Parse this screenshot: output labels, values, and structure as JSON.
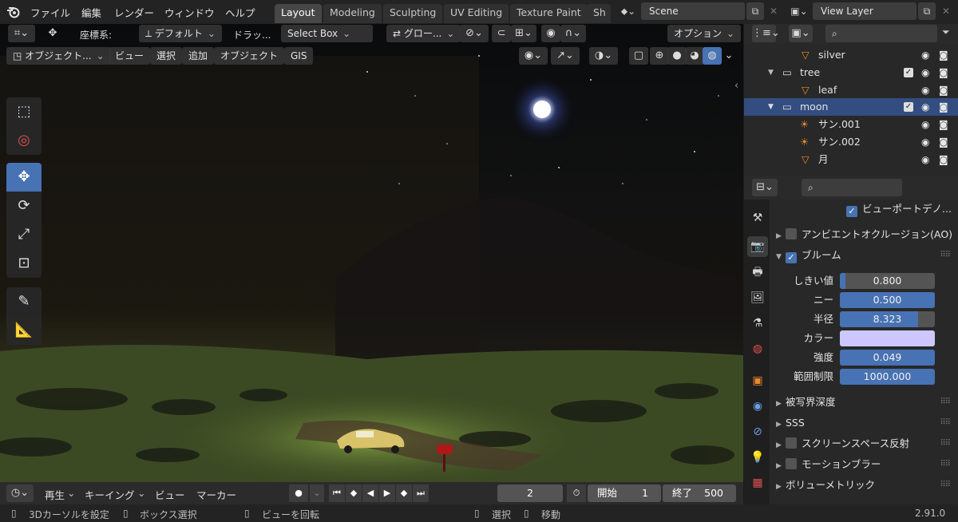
{
  "menubar": {
    "items": [
      "ファイル",
      "編集",
      "レンダー",
      "ウィンドウ",
      "ヘルプ"
    ],
    "workspaces": [
      "Layout",
      "Modeling",
      "Sculpting",
      "UV Editing",
      "Texture Paint",
      "Sh"
    ],
    "active_workspace": "Layout",
    "scene": "Scene",
    "view_layer": "View Layer"
  },
  "viewport_header": {
    "transform_label": "座標系:",
    "orientation": "デフォルト",
    "drag_label": "ドラッ...",
    "select_mode": "Select Box",
    "pivot": "グロー...",
    "options": "オプション",
    "mode": "オブジェクト...",
    "menus": [
      "ビュー",
      "選択",
      "追加",
      "オブジェクト",
      "GIS"
    ]
  },
  "timeline": {
    "playback": "再生",
    "keying": "キーイング",
    "view": "ビュー",
    "marker": "マーカー",
    "current_frame": "2",
    "start_label": "開始",
    "start": "1",
    "end_label": "終了",
    "end": "500"
  },
  "statusbar": {
    "left": "3Dカーソルを設定",
    "box": "ボックス選択",
    "rotate": "ビューを回転",
    "select": "選択",
    "move": "移動",
    "version": "2.91.0"
  },
  "outliner": {
    "rows": [
      {
        "name": "silver",
        "type": "mesh"
      },
      {
        "name": "tree",
        "type": "collection"
      },
      {
        "name": "leaf",
        "type": "mesh"
      },
      {
        "name": "moon",
        "type": "collection",
        "selected": true
      },
      {
        "name": "サン.001",
        "type": "light"
      },
      {
        "name": "サン.002",
        "type": "light"
      },
      {
        "name": "月",
        "type": "mesh"
      }
    ]
  },
  "properties": {
    "denoise_label": "ビューポートデノ...",
    "ao_label": "アンビエントオクルージョン(AO)",
    "bloom_label": "ブルーム",
    "fields": [
      {
        "label": "しきい値",
        "value": "0.800",
        "fill": 0.06
      },
      {
        "label": "ニー",
        "value": "0.500",
        "fill": 1.0
      },
      {
        "label": "半径",
        "value": "8.323",
        "fill": 0.82
      },
      {
        "label": "カラー",
        "value": "",
        "color": "#ccc8ff"
      },
      {
        "label": "強度",
        "value": "0.049",
        "fill": 1.0
      },
      {
        "label": "範囲制限",
        "value": "1000.000",
        "fill": 1.0
      }
    ],
    "panels": [
      "被写界深度",
      "SSS",
      "スクリーンスペース反射",
      "モーションブラー",
      "ボリューメトリック"
    ],
    "accent": "#4772b3"
  }
}
